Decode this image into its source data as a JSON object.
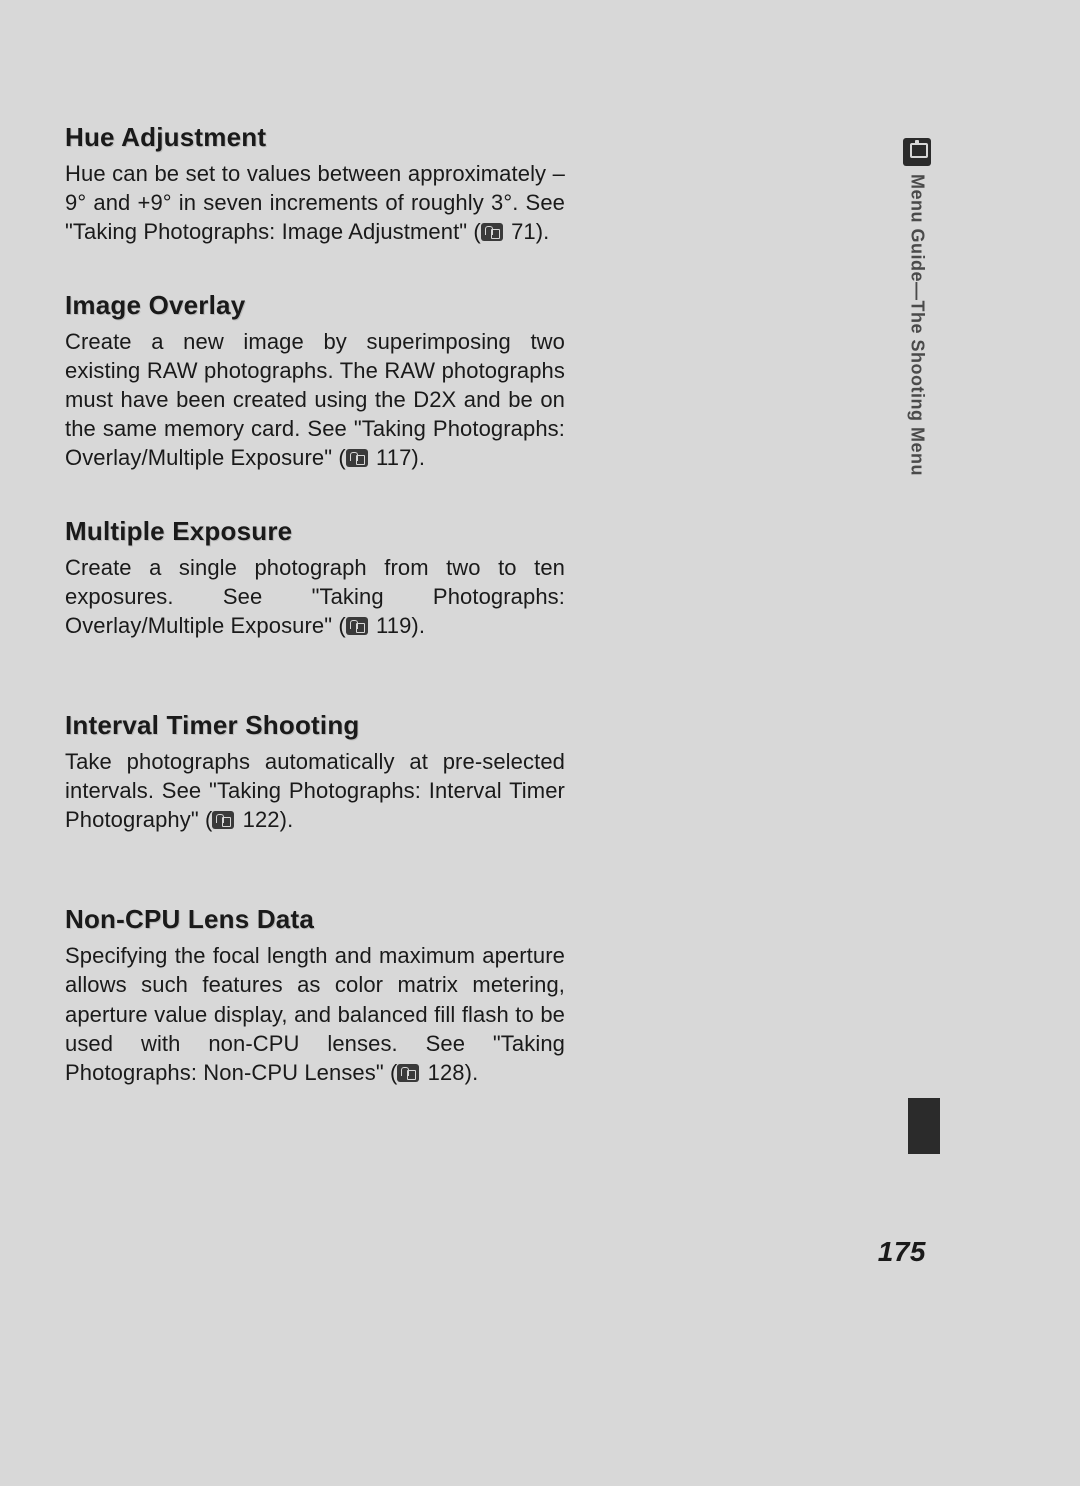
{
  "sections": [
    {
      "heading": "Hue Adjustment",
      "body_pre": "Hue can be set to values between approximately –9° and +9° in seven increments of roughly 3°. See \"Taking Photographs: Image Adjustment\" (",
      "ref": "71",
      "body_post": ")."
    },
    {
      "heading": "Image Overlay",
      "body_pre": "Create a new image by superimposing two existing RAW photographs.  The RAW photographs must have been created using the D2X and be on the same memory card.  See \"Taking Photographs: Overlay/Multiple Exposure\" (",
      "ref": "117",
      "body_post": ")."
    },
    {
      "heading": "Multiple Exposure",
      "body_pre": "Create a single photograph from two to ten exposures.  See \"Taking Photographs: Overlay/Multiple Exposure\" (",
      "ref": "119",
      "body_post": ")."
    },
    {
      "heading": "Interval Timer Shooting",
      "body_pre": "Take photographs automatically at pre-selected intervals.  See \"Taking Photographs: Interval Timer Photography\" (",
      "ref": "122",
      "body_post": ")."
    },
    {
      "heading": "Non-CPU Lens Data",
      "body_pre": "Specifying the focal length and maximum aperture allows such features as color matrix metering, aperture value display, and balanced fill flash to be used with non-CPU lenses.  See \"Taking Photographs: Non-CPU Lenses\" (",
      "ref": "128",
      "body_post": ")."
    }
  ],
  "side_label": "Menu Guide—The Shooting Menu",
  "page_number": "175"
}
